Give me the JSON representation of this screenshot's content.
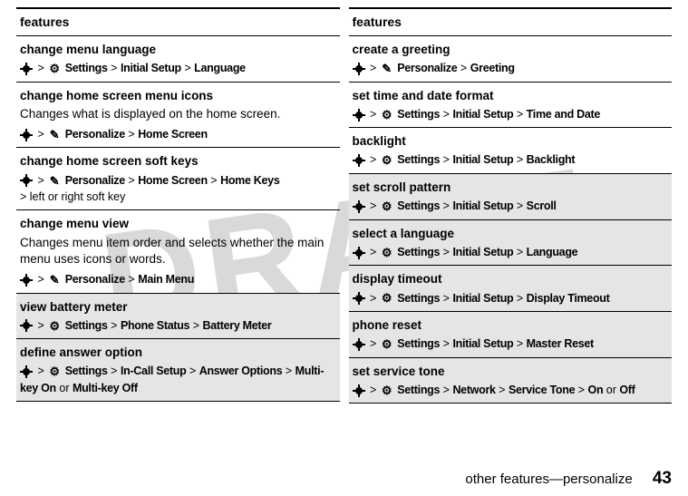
{
  "watermark": "DRAFT",
  "left": {
    "header": "features",
    "rows": [
      {
        "title": "change menu language",
        "path_parts": [
          "Settings",
          "Initial Setup",
          "Language"
        ],
        "icon": "settings"
      },
      {
        "title": "change home screen menu icons",
        "desc": "Changes what is displayed on the home screen.",
        "path_parts": [
          "Personalize",
          "Home Screen"
        ],
        "icon": "personalize"
      },
      {
        "title": "change home screen soft keys",
        "path_parts": [
          "Personalize",
          "Home Screen",
          "Home Keys"
        ],
        "extra": "left or right soft key",
        "icon": "personalize"
      },
      {
        "title": "change menu view",
        "desc": "Changes menu item order and selects whether the main menu uses icons or words.",
        "path_parts": [
          "Personalize",
          "Main Menu"
        ],
        "icon": "personalize"
      },
      {
        "title": "view battery meter",
        "path_parts": [
          "Settings",
          "Phone Status",
          "Battery Meter"
        ],
        "icon": "settings",
        "shaded": true
      },
      {
        "title": "define answer option",
        "path_parts": [
          "Settings",
          "In-Call Setup",
          "Answer Options",
          "Multi-key On"
        ],
        "or": "Multi-key Off",
        "icon": "settings",
        "shaded": true
      }
    ]
  },
  "right": {
    "header": "features",
    "rows": [
      {
        "title": "create a greeting",
        "path_parts": [
          "Personalize",
          "Greeting"
        ],
        "icon": "personalize"
      },
      {
        "title": "set time and date format",
        "path_parts": [
          "Settings",
          "Initial Setup",
          "Time and Date"
        ],
        "icon": "settings"
      },
      {
        "title": "backlight",
        "path_parts": [
          "Settings",
          "Initial Setup",
          "Backlight"
        ],
        "icon": "settings"
      },
      {
        "title": "set scroll pattern",
        "path_parts": [
          "Settings",
          "Initial Setup",
          "Scroll"
        ],
        "icon": "settings",
        "shaded": true
      },
      {
        "title": "select a language",
        "path_parts": [
          "Settings",
          "Initial Setup",
          "Language"
        ],
        "icon": "settings",
        "shaded": true
      },
      {
        "title": "display timeout",
        "path_parts": [
          "Settings",
          "Initial Setup",
          "Display Timeout"
        ],
        "icon": "settings",
        "shaded": true
      },
      {
        "title": "phone reset",
        "path_parts": [
          "Settings",
          "Initial Setup",
          "Master Reset"
        ],
        "icon": "settings",
        "shaded": true
      },
      {
        "title": "set service tone",
        "path_parts": [
          "Settings",
          "Network",
          "Service Tone",
          "On"
        ],
        "or": "Off",
        "icon": "settings",
        "shaded": true
      }
    ]
  },
  "icons": {
    "settings": "⚙",
    "personalize": "✎"
  },
  "sep": ">",
  "or_word": "or",
  "footer_text": "other features—personalize",
  "page_number": "43"
}
